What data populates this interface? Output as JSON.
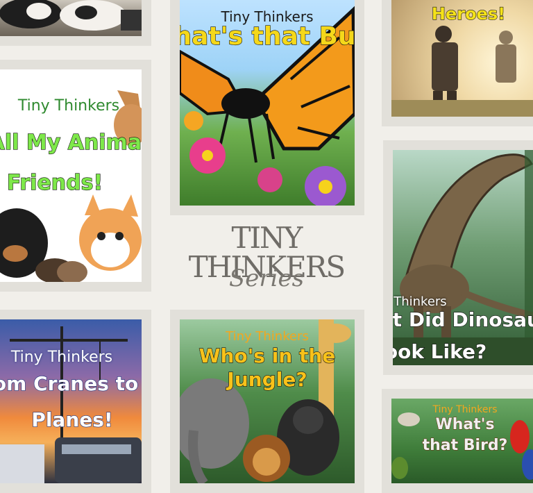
{
  "series": {
    "title": "TINY THINKERS",
    "subtitle": "Series"
  },
  "books": [
    {
      "brand": "Tiny Thinkers",
      "title_line1": "What's that Bug?",
      "title_line2": ""
    },
    {
      "brand": "",
      "title_line1": "Heroes!",
      "title_line2": ""
    },
    {
      "brand": "Tiny Thinkers",
      "title_line1": "All My Animal",
      "title_line2": "Friends!"
    },
    {
      "brand": "Tiny Thinkers",
      "title_line1": "What Did Dinosaurs",
      "title_line2": "Look Like?"
    },
    {
      "brand": "Tiny Thinkers",
      "title_line1": "From Cranes to",
      "title_line2": "Planes!"
    },
    {
      "brand": "Tiny Thinkers",
      "title_line1": "Who's in the",
      "title_line2": "Jungle?"
    },
    {
      "brand": "Tiny Thinkers",
      "title_line1": "What's",
      "title_line2": "that Bird?"
    }
  ],
  "colors": {
    "background": "#f1efea",
    "frame": "#e2e0da",
    "series_text": "#6f6c67"
  }
}
